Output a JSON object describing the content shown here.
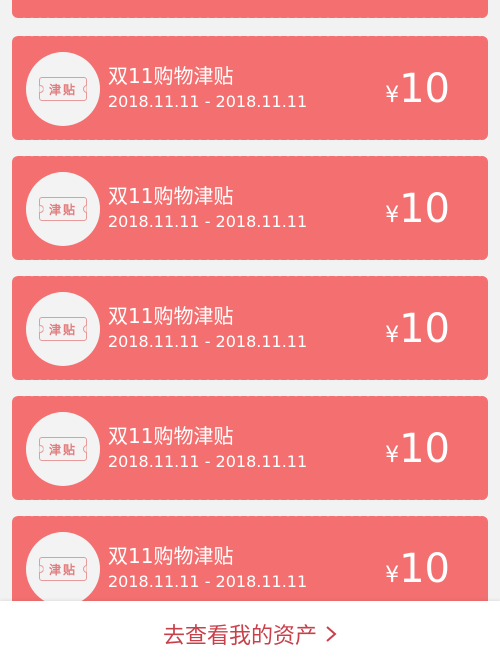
{
  "coupons": [
    {
      "badge": "津贴",
      "title": "双11购物津贴",
      "dates": "2018.11.11 - 2018.11.11",
      "currency": "¥",
      "value": "10"
    },
    {
      "badge": "津贴",
      "title": "双11购物津贴",
      "dates": "2018.11.11 - 2018.11.11",
      "currency": "¥",
      "value": "10"
    },
    {
      "badge": "津贴",
      "title": "双11购物津贴",
      "dates": "2018.11.11 - 2018.11.11",
      "currency": "¥",
      "value": "10"
    },
    {
      "badge": "津贴",
      "title": "双11购物津贴",
      "dates": "2018.11.11 - 2018.11.11",
      "currency": "¥",
      "value": "10"
    },
    {
      "badge": "津贴",
      "title": "双11购物津贴",
      "dates": "2018.11.11 - 2018.11.11",
      "currency": "¥",
      "value": "10"
    }
  ],
  "footer": {
    "link_label": "去查看我的资产",
    "icon": "chevron-right-icon"
  },
  "colors": {
    "coupon_bg": "#f46f6f",
    "link_text": "#c8414a",
    "page_bg": "#f2f2f2"
  }
}
